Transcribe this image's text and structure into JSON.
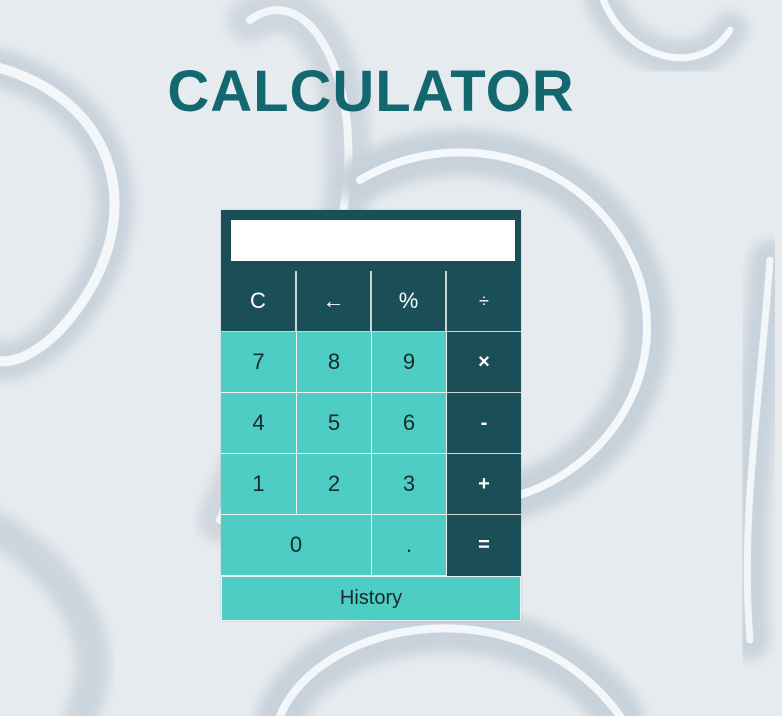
{
  "page": {
    "title": "CALCULATOR"
  },
  "calculator": {
    "display_value": "",
    "top_row": [
      "C",
      "←",
      "%",
      "÷"
    ],
    "rows": [
      [
        "7",
        "8",
        "9",
        "×"
      ],
      [
        "4",
        "5",
        "6",
        "-"
      ],
      [
        "1",
        "2",
        "3",
        "+"
      ]
    ],
    "bottom_row": [
      "0",
      ".",
      "="
    ],
    "history_label": "History"
  },
  "colors": {
    "background": "#e6ebef",
    "title": "#136870",
    "dark_key": "#1b4f58",
    "light_key": "#4ecdc4",
    "display": "#ffffff"
  }
}
